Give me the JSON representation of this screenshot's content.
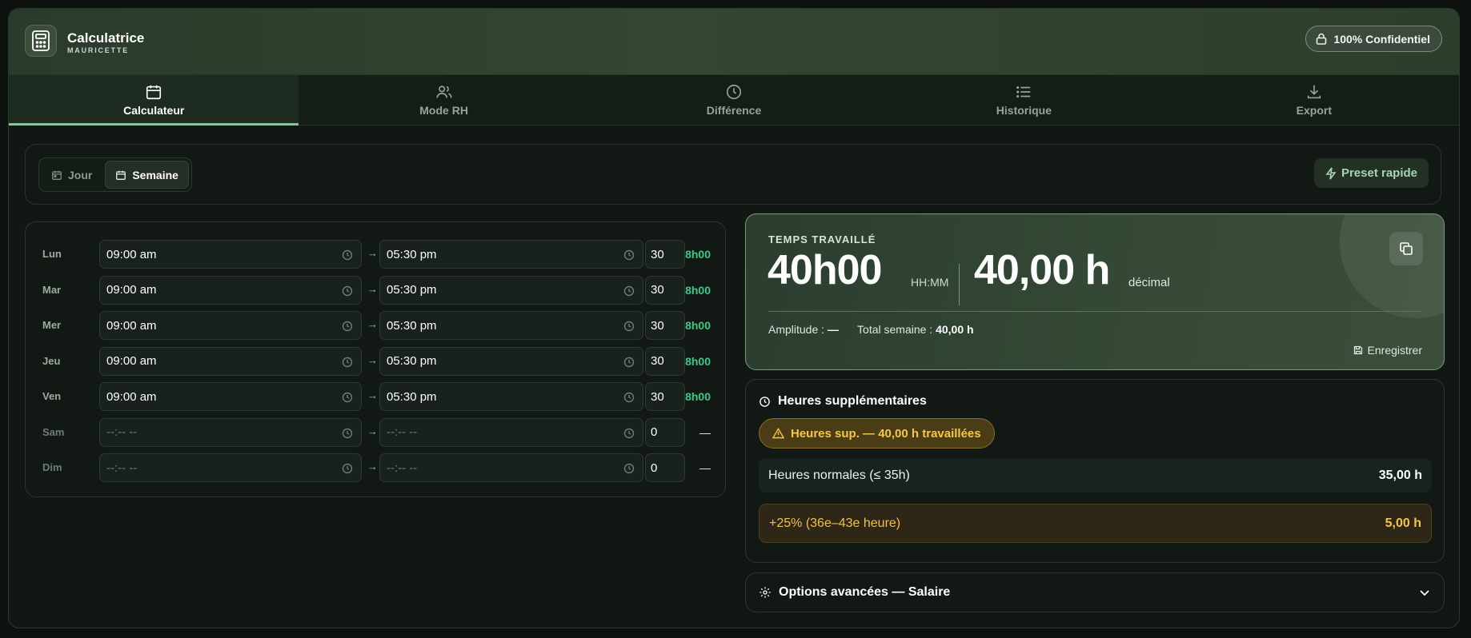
{
  "brand": {
    "title": "Calculatrice",
    "subtitle": "MAURICETTE"
  },
  "header": {
    "confidential": "100% Confidentiel"
  },
  "tabs": [
    {
      "label": "Calculateur",
      "icon": "calendar-icon",
      "active": true
    },
    {
      "label": "Mode RH",
      "icon": "users-icon",
      "active": false
    },
    {
      "label": "Différence",
      "icon": "clock-icon",
      "active": false
    },
    {
      "label": "Historique",
      "icon": "list-icon",
      "active": false
    },
    {
      "label": "Export",
      "icon": "download-icon",
      "active": false
    }
  ],
  "mode": {
    "day": "Jour",
    "week": "Semaine",
    "selected": "Semaine",
    "preset": "Preset rapide"
  },
  "week": {
    "arrow": "→",
    "rows": [
      {
        "day": "Lun",
        "start": "09:00 am",
        "end": "05:30 pm",
        "break": "30",
        "total": "8h00"
      },
      {
        "day": "Mar",
        "start": "09:00 am",
        "end": "05:30 pm",
        "break": "30",
        "total": "8h00"
      },
      {
        "day": "Mer",
        "start": "09:00 am",
        "end": "05:30 pm",
        "break": "30",
        "total": "8h00"
      },
      {
        "day": "Jeu",
        "start": "09:00 am",
        "end": "05:30 pm",
        "break": "30",
        "total": "8h00"
      },
      {
        "day": "Ven",
        "start": "09:00 am",
        "end": "05:30 pm",
        "break": "30",
        "total": "8h00"
      },
      {
        "day": "Sam",
        "start": "--:-- --",
        "end": "--:-- --",
        "break": "0",
        "total": "—"
      },
      {
        "day": "Dim",
        "start": "--:-- --",
        "end": "--:-- --",
        "break": "0",
        "total": "—"
      }
    ]
  },
  "result": {
    "label": "TEMPS TRAVAILLÉ",
    "hhmm": "40h00",
    "hhmm_unit": "HH:MM",
    "decimal": "40,00 h",
    "decimal_unit": "décimal",
    "amplitude_label": "Amplitude :",
    "amplitude_value": "—",
    "total_label": "Total semaine :",
    "total_value": "40,00 h",
    "save": "Enregistrer"
  },
  "overtime": {
    "title": "Heures supplémentaires",
    "warning": "Heures sup. — 40,00 h travaillées",
    "normal_label": "Heures normales (≤ 35h)",
    "normal_value": "35,00 h",
    "plus25_label": "+25% (36e–43e heure)",
    "plus25_value": "5,00 h"
  },
  "options": {
    "title": "Options avancées — Salaire"
  },
  "colors": {
    "accent": "#8fc09a",
    "total_green": "#36c988",
    "warn_yellow": "#f5c746",
    "bg": "#111813"
  }
}
